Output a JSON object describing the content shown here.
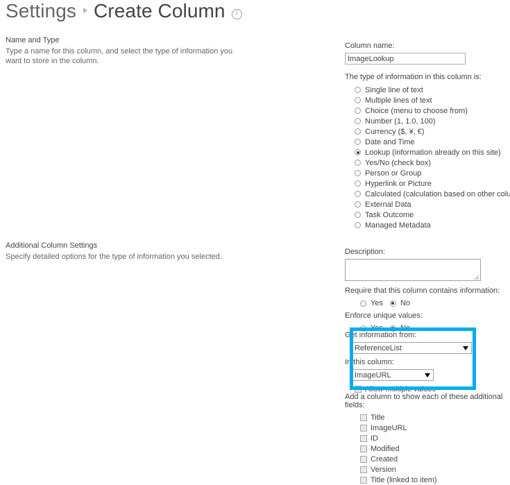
{
  "header": {
    "breadcrumb_parent": "Settings",
    "breadcrumb_separator": "▸",
    "title": "Create Column",
    "info_icon": "info-icon",
    "info_glyph": "i"
  },
  "sections": {
    "name_and_type": {
      "title": "Name and Type",
      "description": "Type a name for this column, and select the type of information you want to store in the column."
    },
    "additional_column_settings": {
      "title": "Additional Column Settings",
      "description": "Specify detailed options for the type of information you selected."
    }
  },
  "form": {
    "column_name_label": "Column name:",
    "column_name_value": "ImageLookup",
    "type_label": "The type of information in this column is:",
    "type_options": [
      {
        "label": "Single line of text",
        "selected": false
      },
      {
        "label": "Multiple lines of text",
        "selected": false
      },
      {
        "label": "Choice (menu to choose from)",
        "selected": false
      },
      {
        "label": "Number (1, 1.0, 100)",
        "selected": false
      },
      {
        "label": "Currency ($, ¥, €)",
        "selected": false
      },
      {
        "label": "Date and Time",
        "selected": false
      },
      {
        "label": "Lookup (information already on this site)",
        "selected": true
      },
      {
        "label": "Yes/No (check box)",
        "selected": false
      },
      {
        "label": "Person or Group",
        "selected": false
      },
      {
        "label": "Hyperlink or Picture",
        "selected": false
      },
      {
        "label": "Calculated (calculation based on other columns)",
        "selected": false
      },
      {
        "label": "External Data",
        "selected": false
      },
      {
        "label": "Task Outcome",
        "selected": false
      },
      {
        "label": "Managed Metadata",
        "selected": false
      }
    ],
    "description_label": "Description:",
    "description_value": "",
    "require_label": "Require that this column contains information:",
    "require_options": [
      {
        "label": "Yes",
        "selected": false
      },
      {
        "label": "No",
        "selected": true
      }
    ],
    "unique_label": "Enforce unique values:",
    "unique_options": [
      {
        "label": "Yes",
        "selected": false
      },
      {
        "label": "No",
        "selected": true
      }
    ],
    "get_info_from_label": "Get information from:",
    "get_info_from_value": "ReferenceList",
    "in_this_column_label": "In this column:",
    "in_this_column_value": "ImageURL",
    "allow_multiple_label": "Allow multiple values",
    "allow_multiple_checked": false,
    "additional_fields_label": "Add a column to show each of these additional fields:",
    "additional_fields": [
      {
        "label": "Title",
        "checked": false
      },
      {
        "label": "ImageURL",
        "checked": false
      },
      {
        "label": "ID",
        "checked": false
      },
      {
        "label": "Modified",
        "checked": false
      },
      {
        "label": "Created",
        "checked": false
      },
      {
        "label": "Version",
        "checked": false
      },
      {
        "label": "Title (linked to item)",
        "checked": false
      }
    ]
  },
  "annotation": {
    "highlight_color": "#00aeef"
  }
}
